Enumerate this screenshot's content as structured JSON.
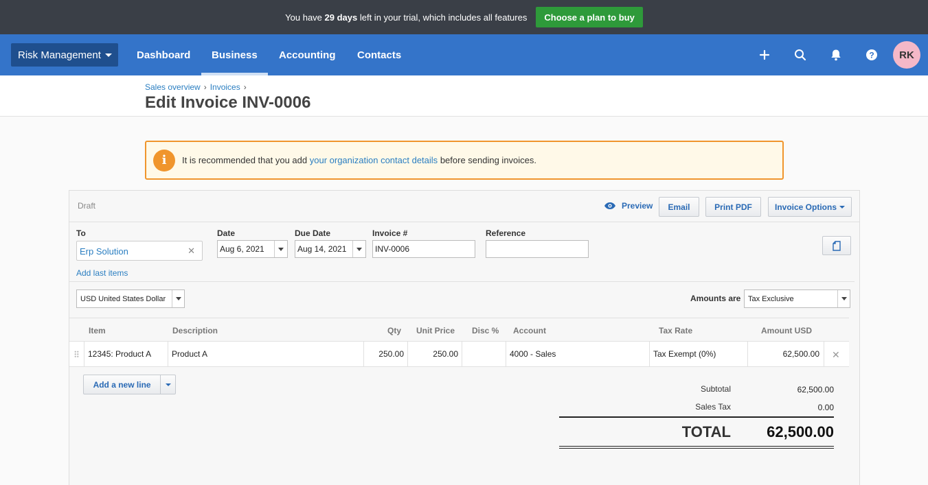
{
  "trial": {
    "text_prefix": "You have ",
    "days": "29 days",
    "text_suffix": " left in your trial, which includes all features",
    "cta": "Choose a plan to buy"
  },
  "nav": {
    "org": "Risk Management",
    "links": [
      "Dashboard",
      "Business",
      "Accounting",
      "Contacts"
    ],
    "active": "Business",
    "icons": [
      "plus-icon",
      "search-icon",
      "bell-icon",
      "help-icon"
    ],
    "avatar": "RK"
  },
  "breadcrumb": [
    "Sales overview",
    "Invoices"
  ],
  "page_title": "Edit Invoice INV-0006",
  "notice": {
    "before": "It is recommended that you add ",
    "link": "your organization contact details",
    "after": " before sending invoices."
  },
  "invoice": {
    "status": "Draft",
    "toolbar": {
      "preview": "Preview",
      "email": "Email",
      "print": "Print PDF",
      "options": "Invoice Options"
    },
    "labels": {
      "to": "To",
      "date": "Date",
      "due_date": "Due Date",
      "invoice_no": "Invoice #",
      "reference": "Reference"
    },
    "to": "Erp Solution",
    "date": "Aug 6, 2021",
    "due_date": "Aug 14, 2021",
    "invoice_no": "INV-0006",
    "reference": "",
    "add_last_items": "Add last items",
    "currency": "USD United States Dollar",
    "amounts_are_label": "Amounts are",
    "amounts_are": "Tax Exclusive",
    "columns": [
      "Item",
      "Description",
      "Qty",
      "Unit Price",
      "Disc %",
      "Account",
      "Tax Rate",
      "Amount USD"
    ],
    "lines": [
      {
        "item": "12345: Product A",
        "description": "Product A",
        "qty": "250.00",
        "unit_price": "250.00",
        "disc": "",
        "account": "4000 - Sales",
        "tax_rate": "Tax Exempt (0%)",
        "amount": "62,500.00"
      }
    ],
    "add_line": "Add a new line",
    "totals": {
      "subtotal_label": "Subtotal",
      "subtotal": "62,500.00",
      "tax_label": "Sales Tax",
      "tax": "0.00",
      "total_label": "TOTAL",
      "total": "62,500.00"
    }
  },
  "colors": {
    "trial_bg": "#3a3f47",
    "cta_green": "#2e9a3a",
    "nav_blue": "#3474c9",
    "org_btn": "#1f4f8e",
    "link_blue": "#2a7ec1",
    "warning_orange": "#f0952c",
    "avatar_pink": "#f4b8c8"
  }
}
